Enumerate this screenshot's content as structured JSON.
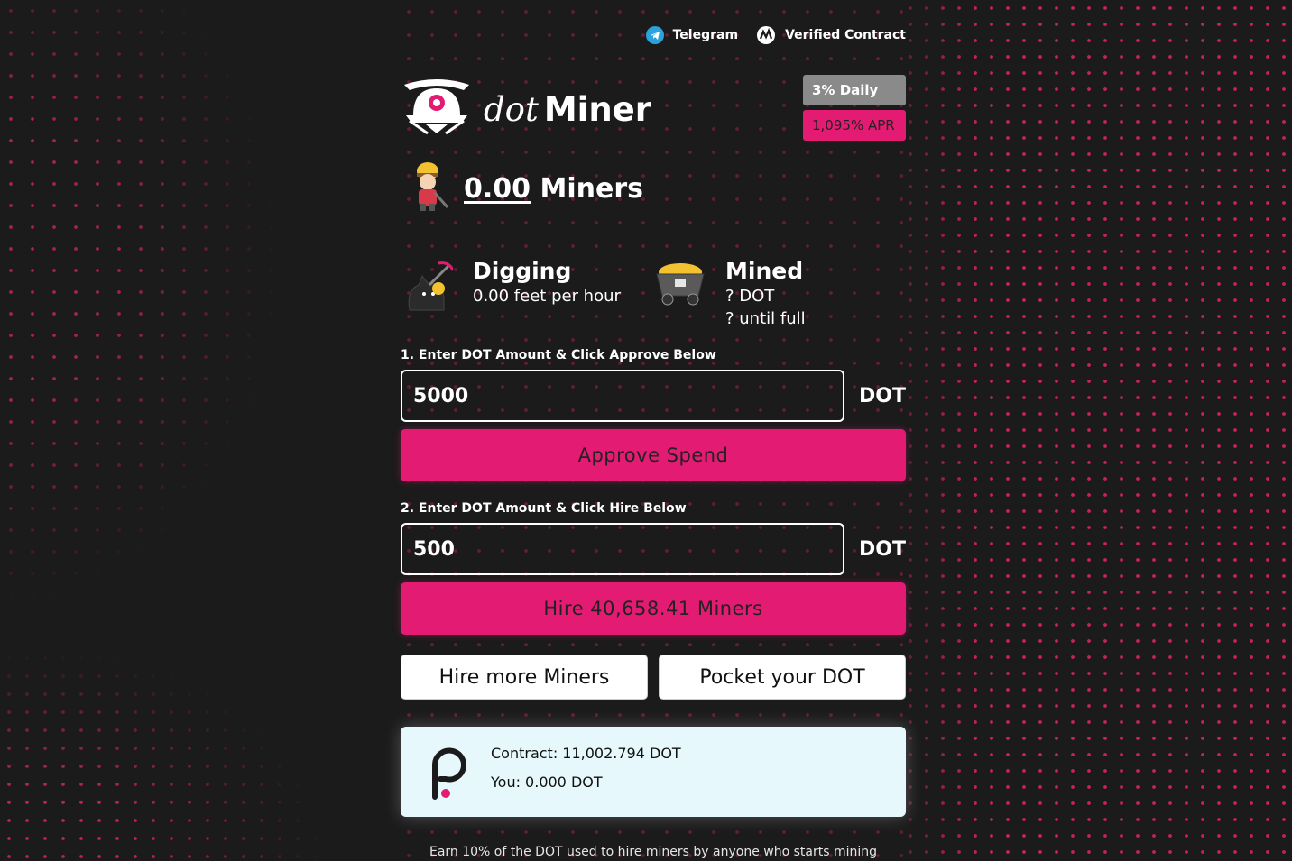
{
  "topbar": {
    "telegram_label": "Telegram",
    "verified_label": "Verified Contract",
    "telegram_icon": "telegram-icon",
    "verified_icon": "contract-icon"
  },
  "brand": {
    "logo_dot": "dot",
    "logo_name": "Miner",
    "logo_icon": "miner-helmet-logo"
  },
  "badges": {
    "daily": "3% Daily",
    "apr": "1,095% APR"
  },
  "miners": {
    "count": "0.00",
    "label": "Miners"
  },
  "digging": {
    "title": "Digging",
    "rate": "0.00 feet per hour"
  },
  "mined": {
    "title": "Mined",
    "amount": "? DOT",
    "until_full": "? until full"
  },
  "approve": {
    "step_label": "1. Enter DOT Amount & Click Approve Below",
    "value": "5000",
    "unit": "DOT",
    "button_label": "Approve Spend"
  },
  "hire": {
    "step_label": "2. Enter DOT Amount & Click Hire Below",
    "value": "500",
    "unit": "DOT",
    "button_label": "Hire 40,658.41 Miners"
  },
  "actions": {
    "hire_more": "Hire more Miners",
    "pocket": "Pocket your DOT"
  },
  "balances": {
    "contract": "Contract: 11,002.794 DOT",
    "you": "You: 0.000 DOT"
  },
  "footer": {
    "note": "Earn 10% of the DOT used to hire miners by anyone who starts mining"
  },
  "colors": {
    "accent": "#e41b73",
    "background": "#1b1b1b",
    "card": "#e6f8fc",
    "badge_gray": "#8a8a8a"
  }
}
